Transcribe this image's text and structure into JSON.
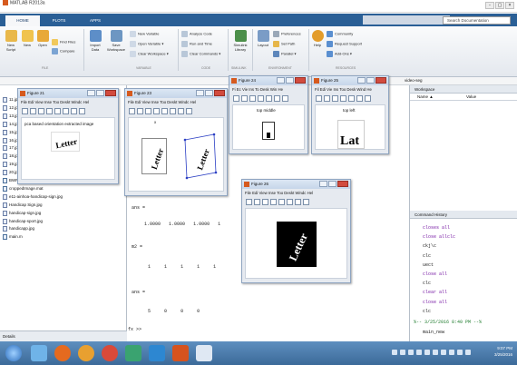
{
  "app": {
    "title": "MATLAB R2013a",
    "window_controls": [
      "-",
      "▢",
      "×"
    ],
    "tabs": [
      {
        "label": "HOME",
        "active": true
      },
      {
        "label": "PLOTS",
        "active": false
      },
      {
        "label": "APPS",
        "active": false
      }
    ],
    "search_placeholder": "Search Documentation"
  },
  "ribbon": {
    "file_buttons": [
      {
        "label": "New Script",
        "icon": "new-script-icon"
      },
      {
        "label": "New",
        "icon": "new-icon"
      },
      {
        "label": "Open",
        "icon": "open-icon"
      },
      {
        "label": "Find Files",
        "icon": "find-files-icon"
      },
      {
        "label": "Compare",
        "icon": "compare-icon"
      }
    ],
    "variable_buttons": [
      {
        "label": "Import Data",
        "icon": "import-data-icon"
      },
      {
        "label": "Save Workspace",
        "icon": "save-workspace-icon"
      }
    ],
    "variable_small": [
      "New Variable",
      "Open Variable ▾",
      "Clear Workspace ▾"
    ],
    "code_small": [
      "Analyze Code",
      "Run and Time",
      "Clear Commands ▾"
    ],
    "simulink_label": "Simulink Library",
    "layout_label": "Layout",
    "environment_small": [
      "Preferences",
      "Set Path",
      "Parallel ▾"
    ],
    "help_label": "Help",
    "resources_small": [
      "Community",
      "Request Support",
      "Add-Ons ▾"
    ],
    "sections": [
      "FILE",
      "VARIABLE",
      "CODE",
      "SIMULINK",
      "ENVIRONMENT",
      "RESOURCES"
    ],
    "accent": "#2a5f96"
  },
  "files": [
    "11.jpg",
    "12.jpg",
    "13.jpg",
    "14.jpg",
    "15.jpg",
    "16.jpg",
    "17.jpg",
    "18.jpg",
    "19.jpg",
    "20.jpg",
    "BWPCAOrient.m",
    "croppedImage.mat",
    "e11-ainhoa-handicap-sign.jpg",
    "Handicap Sign.jpg",
    "handicap-sign.jpg",
    "handicap-sport.jpg",
    "handicapp.jpg",
    "main.m"
  ],
  "details_label": "Details",
  "command_window": {
    "prompt_partial": "ans =",
    "row1": [
      "1.0000",
      "1.0000",
      "1.0000",
      "1"
    ],
    "m2_label": "m2 =",
    "row2": [
      "1",
      "1",
      "1",
      "1",
      "1"
    ],
    "ans_label": "ans =",
    "row3": [
      "5",
      "0",
      "0",
      "0"
    ],
    "prompt": "fx >>"
  },
  "current_folder_tail": "video-seg",
  "workspace": {
    "title": "Workspace",
    "columns": [
      "Name ▲",
      "Value"
    ]
  },
  "history": {
    "title": "Command History",
    "entries": [
      "closes all",
      "close allclc",
      "ckj\\c",
      "clc",
      "uect",
      "close all",
      "clc",
      "clear all",
      "close all",
      "clc"
    ],
    "timestamp": "%-- 3/25/2016 8:40 PM --%",
    "last": "main_new"
  },
  "figures": [
    {
      "title": "Figure 21",
      "menu": "File  Edi  View  Inse  Too  Deskt  Windc  Hel",
      "caption": "pca based orientation extracted image",
      "word": "Letter"
    },
    {
      "title": "Figure 23",
      "menu": "File  Edi  View  Inse  Too  Deskt  Windc  Hel",
      "label_x": "x",
      "word": "Letter"
    },
    {
      "title": "Figure 24",
      "menu": "Fi  Ec  Vie  Ins  To  Desk  Win  He",
      "caption": "top middle"
    },
    {
      "title": "Figure 25",
      "menu": "Fil  Edi  Vie  Ins  Too  Desk  Wind  He",
      "caption": "top left",
      "word": "Lat"
    },
    {
      "title": "Figure 26",
      "menu": "File  Edi  View  Inse  Too  Deskt  Windc  Hel",
      "word": "Letter"
    }
  ],
  "clock": {
    "time": "9:07 PM",
    "date": "3/25/2016"
  }
}
